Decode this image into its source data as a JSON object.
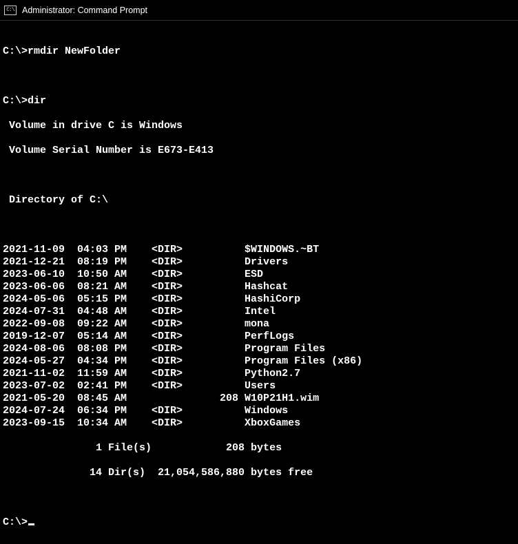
{
  "window": {
    "title": "Administrator: Command Prompt",
    "icon_label": "C:\\"
  },
  "session": {
    "prompt": "C:\\>",
    "commands": {
      "cmd1": "rmdir NewFolder",
      "cmd2": "dir"
    },
    "volume_line": " Volume in drive C is Windows",
    "serial_line": " Volume Serial Number is E673-E413",
    "directory_line": " Directory of C:\\",
    "entries": [
      {
        "date": "2021-11-09",
        "time": "04:03 PM",
        "dir": "<DIR>",
        "size": "",
        "name": "$WINDOWS.~BT"
      },
      {
        "date": "2021-12-21",
        "time": "08:19 PM",
        "dir": "<DIR>",
        "size": "",
        "name": "Drivers"
      },
      {
        "date": "2023-06-10",
        "time": "10:50 AM",
        "dir": "<DIR>",
        "size": "",
        "name": "ESD"
      },
      {
        "date": "2023-06-06",
        "time": "08:21 AM",
        "dir": "<DIR>",
        "size": "",
        "name": "Hashcat"
      },
      {
        "date": "2024-05-06",
        "time": "05:15 PM",
        "dir": "<DIR>",
        "size": "",
        "name": "HashiCorp"
      },
      {
        "date": "2024-07-31",
        "time": "04:48 AM",
        "dir": "<DIR>",
        "size": "",
        "name": "Intel"
      },
      {
        "date": "2022-09-08",
        "time": "09:22 AM",
        "dir": "<DIR>",
        "size": "",
        "name": "mona"
      },
      {
        "date": "2019-12-07",
        "time": "05:14 AM",
        "dir": "<DIR>",
        "size": "",
        "name": "PerfLogs"
      },
      {
        "date": "2024-08-06",
        "time": "08:08 PM",
        "dir": "<DIR>",
        "size": "",
        "name": "Program Files"
      },
      {
        "date": "2024-05-27",
        "time": "04:34 PM",
        "dir": "<DIR>",
        "size": "",
        "name": "Program Files (x86)"
      },
      {
        "date": "2021-11-02",
        "time": "11:59 AM",
        "dir": "<DIR>",
        "size": "",
        "name": "Python2.7"
      },
      {
        "date": "2023-07-02",
        "time": "02:41 PM",
        "dir": "<DIR>",
        "size": "",
        "name": "Users"
      },
      {
        "date": "2021-05-20",
        "time": "08:45 AM",
        "dir": "",
        "size": "208",
        "name": "W10P21H1.wim"
      },
      {
        "date": "2024-07-24",
        "time": "06:34 PM",
        "dir": "<DIR>",
        "size": "",
        "name": "Windows"
      },
      {
        "date": "2023-09-15",
        "time": "10:34 AM",
        "dir": "<DIR>",
        "size": "",
        "name": "XboxGames"
      }
    ],
    "summary": {
      "files_line": "               1 File(s)            208 bytes",
      "dirs_line": "              14 Dir(s)  21,054,586,880 bytes free"
    }
  }
}
